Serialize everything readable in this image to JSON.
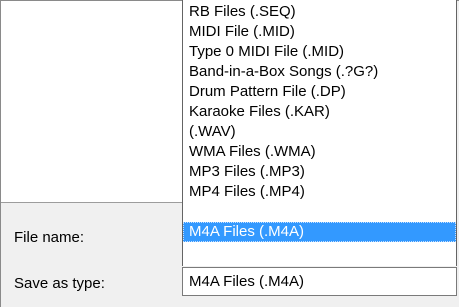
{
  "labels": {
    "file_name": "File name:",
    "save_as_type": "Save as type:"
  },
  "dropdown": {
    "items": [
      "RB Files (.SEQ)",
      "MIDI File (.MID)",
      "Type 0 MIDI File (.MID)",
      "Band-in-a-Box Songs (.?G?)",
      "Drum Pattern File (.DP)",
      "Karaoke Files (.KAR)",
      "(.WAV)",
      "WMA Files (.WMA)",
      "MP3 Files (.MP3)",
      "MP4 Files (.MP4)",
      "M4A Files (.M4A)"
    ],
    "selected": "M4A Files (.M4A)"
  },
  "combo": {
    "value": "M4A Files (.M4A)"
  },
  "colors": {
    "selection": "#3399ff",
    "selection_text": "#ffffff",
    "list_background": "#ffffff",
    "dialog_background": "#f0f0f0"
  }
}
